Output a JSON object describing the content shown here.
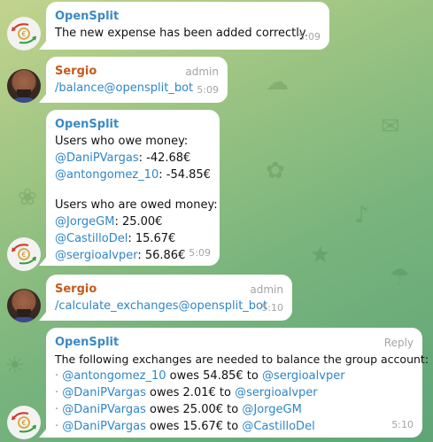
{
  "colors": {
    "bot_name": "#3a8ac4",
    "user_name": "#c55a1c",
    "link": "#2f86c7",
    "meta": "#a4a4a4",
    "bubble": "#ffffff"
  },
  "messages": [
    {
      "sender": "OpenSplit",
      "text": "The new expense has been added correctly.",
      "time": "5:09"
    },
    {
      "sender": "Sergio",
      "role": "admin",
      "command": "/balance@opensplit_bot",
      "time": "5:09"
    },
    {
      "sender": "OpenSplit",
      "owe_heading": "Users who owe money:",
      "owe": [
        {
          "user": "@DaniPVargas",
          "amount": ": -42.68€"
        },
        {
          "user": "@antongomez_10",
          "amount": ": -54.85€"
        }
      ],
      "owed_heading": "Users who are owed money:",
      "owed": [
        {
          "user": "@JorgeGM",
          "amount": ": 25.00€"
        },
        {
          "user": "@CastilloDel",
          "amount": ": 15.67€"
        },
        {
          "user": "@sergioalvper",
          "amount": ": 56.86€"
        }
      ],
      "time": "5:09"
    },
    {
      "sender": "Sergio",
      "role": "admin",
      "command": "/calculate_exchanges@opensplit_bot",
      "time": "5:10"
    },
    {
      "sender": "OpenSplit",
      "reply_label": "Reply",
      "text": "The following exchanges are needed to balance the group account:",
      "bullet": "·",
      "exchanges": [
        {
          "from": "@antongomez_10",
          "verb": "owes 54.85€ to",
          "to": "@sergioalvper"
        },
        {
          "from": "@DaniPVargas",
          "verb": "owes 2.01€ to",
          "to": "@sergioalvper"
        },
        {
          "from": "@DaniPVargas",
          "verb": "owes 25.00€ to",
          "to": "@JorgeGM"
        },
        {
          "from": "@DaniPVargas",
          "verb": "owes 15.67€ to",
          "to": "@CastilloDel"
        }
      ],
      "time": "5:10"
    }
  ],
  "icons": {
    "bot_avatar": "opensplit-logo-icon",
    "user_avatar": "user-photo",
    "background": "doodle-pattern"
  }
}
